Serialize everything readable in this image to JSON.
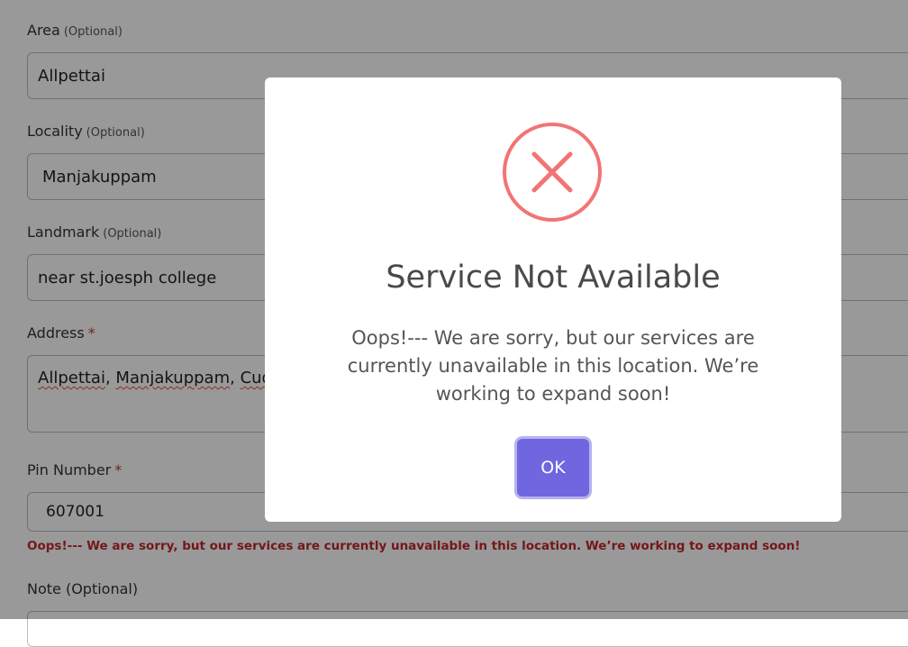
{
  "form": {
    "area": {
      "label": "Area",
      "optional_tag": "(Optional)",
      "value": "Allpettai"
    },
    "locality": {
      "label": "Locality",
      "optional_tag": "(Optional)",
      "value": "Manjakuppam"
    },
    "landmark": {
      "label": "Landmark",
      "optional_tag": "(Optional)",
      "value": "near st.joesph college"
    },
    "address": {
      "label": "Address",
      "required_mark": "*",
      "value_parts": [
        "Allpettai",
        ", ",
        "Manjakuppam",
        ", ",
        "Cuddalore"
      ]
    },
    "pin": {
      "label": "Pin Number",
      "required_mark": "*",
      "value": "607001"
    },
    "pin_error": "Oops!--- We are sorry, but our services are currently unavailable in this location. We’re working to expand soon!",
    "note": {
      "label": "Note (Optional)"
    }
  },
  "modal": {
    "title": "Service Not Available",
    "message": "Oops!--- We are sorry, but our services are currently unavailable in this location. We’re working to expand soon!",
    "ok_label": "OK",
    "icon": "error-x-icon"
  },
  "colors": {
    "overlay": "rgba(0,0,0,0.4)",
    "error_icon": "#f27474",
    "ok_button": "#7066e0",
    "error_text": "#c1272d"
  }
}
